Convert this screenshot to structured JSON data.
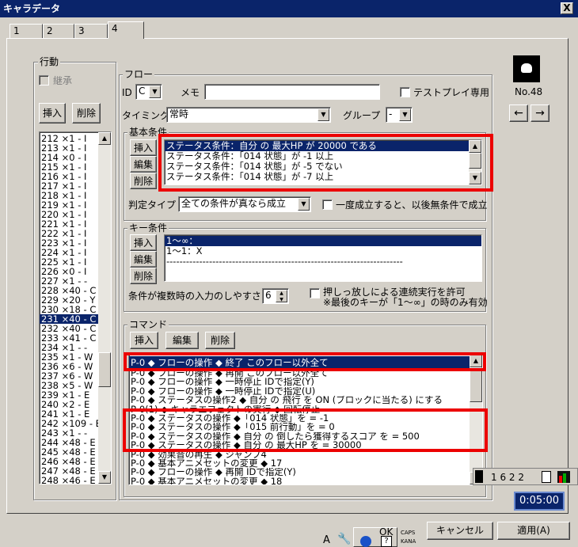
{
  "window": {
    "title": "キャラデータ",
    "close": "X"
  },
  "tabs": [
    "1",
    "2",
    "3",
    "4"
  ],
  "action": {
    "title": "行動",
    "inherit_label": "継承",
    "insert": "挿入",
    "delete": "削除",
    "items": [
      "212 ×1 - I",
      "213 ×1 - I",
      "214 ×0 - I",
      "215 ×1 - I",
      "216 ×1 - I",
      "217 ×1 - I",
      "218 ×1 - I",
      "219 ×1 - I",
      "220 ×1 - I",
      "221 ×1 - I",
      "222 ×1 - I",
      "223 ×1 - I",
      "224 ×1 - I",
      "225 ×1 - I",
      "226 ×0 - I",
      "227 ×1 - -",
      "228 ×40 - C",
      "229 ×20 - Y",
      "230 ×18 - C",
      "231 ×40 - C",
      "232 ×40 - C",
      "233 ×41 - C",
      "234 ×1 - -",
      "235 ×1 - W",
      "236 ×6 - W",
      "237 ×6 - W",
      "238 ×5 - W",
      "239 ×1 - E",
      "240 ×2 - E",
      "241 ×1 - E",
      "242 ×109 - E",
      "243 ×1 - -",
      "244 ×48 - E",
      "245 ×48 - E",
      "246 ×48 - E",
      "247 ×48 - E",
      "248 ×46 - E"
    ],
    "selected_index": 19
  },
  "flow": {
    "title": "フロー",
    "id_label": "ID",
    "id_value": "C",
    "memo_label": "メモ",
    "memo_value": "",
    "testplay_label": "テストプレイ専用",
    "timing_label": "タイミング",
    "timing_value": "常時",
    "group_label": "グループ",
    "group_value": "-"
  },
  "basic": {
    "title": "基本条件",
    "insert": "挿入",
    "edit": "編集",
    "delete": "削除",
    "items": [
      "ステータス条件：自分 の 最大HP が 20000 である",
      "ステータス条件：「014 状態」が -1 以上",
      "ステータス条件：「014 状態」が -5 でない",
      "ステータス条件：「014 状態」が -7 以上"
    ],
    "judge_label": "判定タイプ",
    "judge_value": "全ての条件が真なら成立",
    "once_label": "一度成立すると、以後無条件で成立"
  },
  "key": {
    "title": "キー条件",
    "insert": "挿入",
    "edit": "編集",
    "delete": "削除",
    "items": [
      "1～∞：",
      "1～1：X",
      "------------------------------------------------------------------------"
    ],
    "ease_label": "条件が複数時の入力のしやすさ",
    "ease_value": "6",
    "hold_label": "押しっ放しによる連続実行を許可",
    "hold_note": "※最後のキーが「1～∞」の時のみ有効"
  },
  "command": {
    "title": "コマンド",
    "insert": "挿入",
    "edit": "編集",
    "delete": "削除",
    "items": [
      "P-0 ◆ フローの操作 ◆ 終了 このフロー以外全て",
      "P-0 ◆ フローの操作 ◆ 再開 このフロー以外全て",
      "P-0 ◆ フローの操作 ◆ 一時停止 IDで指定(Y)",
      "P-0 ◆ フローの操作 ◆ 一時停止 IDで指定(U)",
      "P-0 ◆ ステータスの操作2 ◆ 自分 の 飛行 を ON (ブロックに当たる) にする",
      "P-0(1) ◆ キャラエフェクトの実行 ◆ 回転停止",
      "P-0 ◆ ステータスの操作 ◆「014 状態」を = -1",
      "P-0 ◆ ステータスの操作 ◆「015 前行動」を = 0",
      "P-0 ◆ ステータスの操作 ◆ 自分 の 倒したら獲得するスコア を = 500",
      "P-0 ◆ ステータスの操作 ◆ 自分 の 最大HP を = 30000",
      "P-0 ◆ 効果音の再生 ◆ ジャンプ4",
      "P-0 ◆ 基本アニメセットの変更 ◆ 17",
      "P-0 ◆ フローの操作 ◆ 再開 IDで指定(Y)",
      "P-0 ◆ 基本アニメセットの変更 ◆ 18"
    ]
  },
  "preview": {
    "label": "No.48"
  },
  "bottom": {
    "ok": "OK",
    "cancel": "キャンセル",
    "apply": "適用(A)",
    "caps": "CAPS",
    "kana": "KANA"
  },
  "taskbar": {
    "clock": "0:05:00",
    "tray": "1 6 2 2"
  }
}
